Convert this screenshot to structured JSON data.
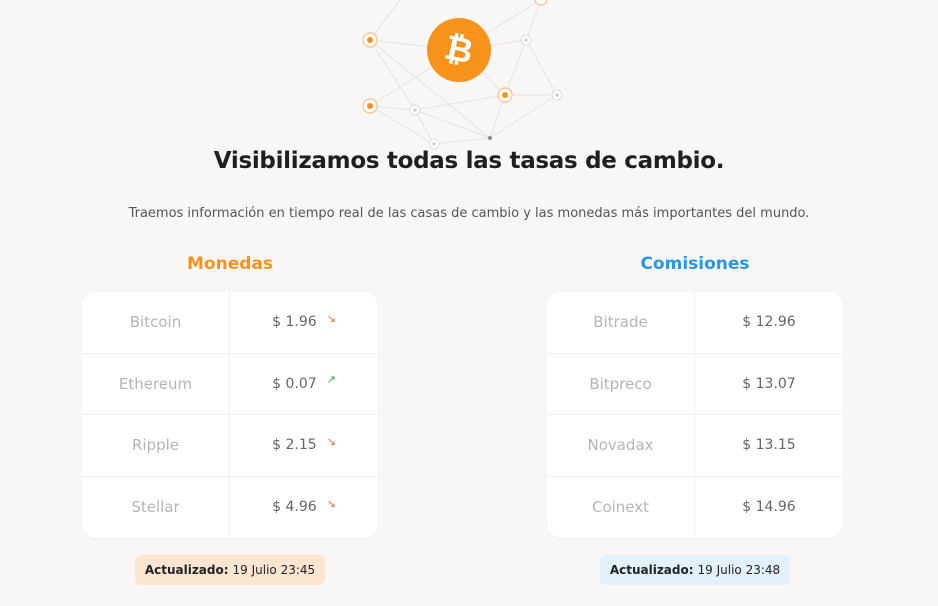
{
  "hero": {
    "icon": "bitcoin-icon",
    "brand_color": "#f7931a"
  },
  "headline": "Visibilizamos todas las tasas de cambio.",
  "subline": "Traemos información en tiempo real de las casas de cambio y las monedas más importantes del mundo.",
  "monedas": {
    "title": "Monedas",
    "title_color": "#f7931a",
    "rows": [
      {
        "name": "Bitcoin",
        "value": "$ 1.96",
        "trend": "down",
        "trend_glyph": "↘"
      },
      {
        "name": "Ethereum",
        "value": "$ 0.07",
        "trend": "up",
        "trend_glyph": "↗"
      },
      {
        "name": "Ripple",
        "value": "$ 2.15",
        "trend": "down",
        "trend_glyph": "↘"
      },
      {
        "name": "Stellar",
        "value": "$ 4.96",
        "trend": "down",
        "trend_glyph": "↘"
      }
    ],
    "updated_label": "Actualizado:",
    "updated_value": "19 Julio 23:45"
  },
  "comisiones": {
    "title": "Comisiones",
    "title_color": "#2a96e6",
    "rows": [
      {
        "name": "Bitrade",
        "value": "$ 12.96"
      },
      {
        "name": "Bitpreco",
        "value": "$ 13.07"
      },
      {
        "name": "Novadax",
        "value": "$ 13.15"
      },
      {
        "name": "Coinext",
        "value": "$ 14.96"
      }
    ],
    "updated_label": "Actualizado:",
    "updated_value": "19 Julio 23:48"
  }
}
